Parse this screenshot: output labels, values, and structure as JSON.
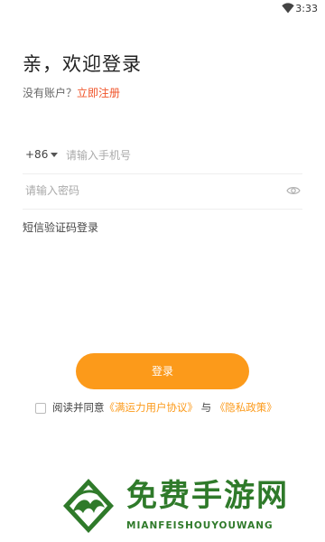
{
  "status_bar": {
    "time": "3:33",
    "wifi_icon": "wifi-icon"
  },
  "header": {
    "title": "亲，欢迎登录",
    "no_account_text": "没有账户？",
    "register_link": "立即注册"
  },
  "form": {
    "country_code": "+86",
    "phone_placeholder": "请输入手机号",
    "password_placeholder": "请输入密码",
    "eye_icon": "eye-icon",
    "sms_login_label": "短信验证码登录"
  },
  "login_button_label": "登录",
  "agreement": {
    "prefix": "阅读并同意",
    "user_agreement_link": "《满运力用户协议》",
    "connector": "与",
    "privacy_link": "《隐私政策》"
  },
  "watermark": {
    "title": "免费手游网",
    "subtitle": "MIANFEISHOUYOUWANG"
  },
  "colors": {
    "accent_orange": "#fc9a1a",
    "register_red": "#f0542a",
    "watermark_green": "#2f7a2a"
  }
}
